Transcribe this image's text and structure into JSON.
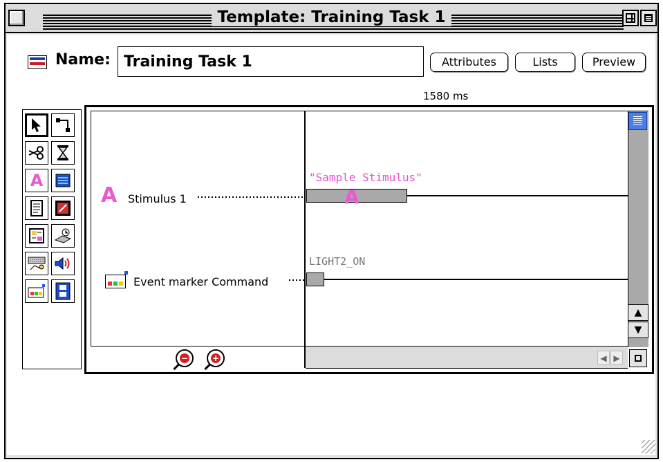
{
  "window": {
    "title": "Template: Training Task 1"
  },
  "header": {
    "name_label": "Name:",
    "name_value": "Training Task 1",
    "buttons": {
      "attributes": "Attributes",
      "lists": "Lists",
      "preview": "Preview"
    }
  },
  "timeline": {
    "time_marker": "1580 ms",
    "rows": [
      {
        "label": "Stimulus 1",
        "icon": "stimulus-a-icon",
        "bar_text": "\"Sample Stimulus\""
      },
      {
        "label": "Event marker Command",
        "icon": "event-marker-icon",
        "bar_text": "LIGHT2_ON"
      }
    ]
  },
  "tools": [
    "arrow-pointer-icon",
    "connector-icon",
    "scissors-icon",
    "hourglass-icon",
    "stimulus-a-icon",
    "grid-display-icon",
    "document-icon",
    "image-icon",
    "form-icon",
    "response-device-icon",
    "keyboard-icon",
    "speaker-icon",
    "event-marker-icon",
    "film-strip-icon"
  ],
  "colors": {
    "stimulus_pink": "#e85ad0",
    "scroll_thumb_blue": "#4a7fe8",
    "bar_gray": "#a9a9a9"
  }
}
